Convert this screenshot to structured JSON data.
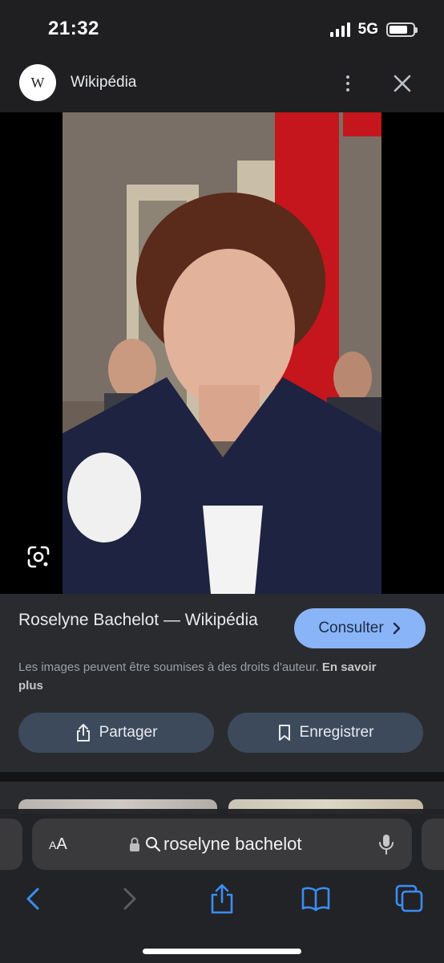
{
  "status_bar": {
    "time": "21:32",
    "network": "5G",
    "battery_level": 0.8,
    "signal_bars": 4
  },
  "header": {
    "logo_letter": "W",
    "site_name": "Wikipédia",
    "icons": [
      "more-vert-icon",
      "close-icon"
    ]
  },
  "image_viewer": {
    "lens_icon": "google-lens-icon"
  },
  "result": {
    "title": "Roselyne Bachelot — Wikipédia",
    "consult_label": "Consulter",
    "consult_icon": "chevron-right-icon",
    "copyright_text": "Les images peuvent être soumises à des droits d'auteur.",
    "learn_more": "En savoir plus",
    "share_label": "Partager",
    "share_icon": "share-icon",
    "save_label": "Enregistrer",
    "save_icon": "bookmark-icon"
  },
  "safari": {
    "text_size_label_big": "A",
    "text_size_label_small": "A",
    "url_text": "roselyne bachelot",
    "nav_icons": [
      "back-icon",
      "forward-icon",
      "share-icon",
      "bookmarks-icon",
      "tabs-icon"
    ]
  },
  "colors": {
    "background": "#1f1f21",
    "panel": "#2a2b2e",
    "accent_button": "#8ab4f8",
    "secondary_button": "#3c4a5c",
    "safari_blue": "#3b8df7"
  }
}
